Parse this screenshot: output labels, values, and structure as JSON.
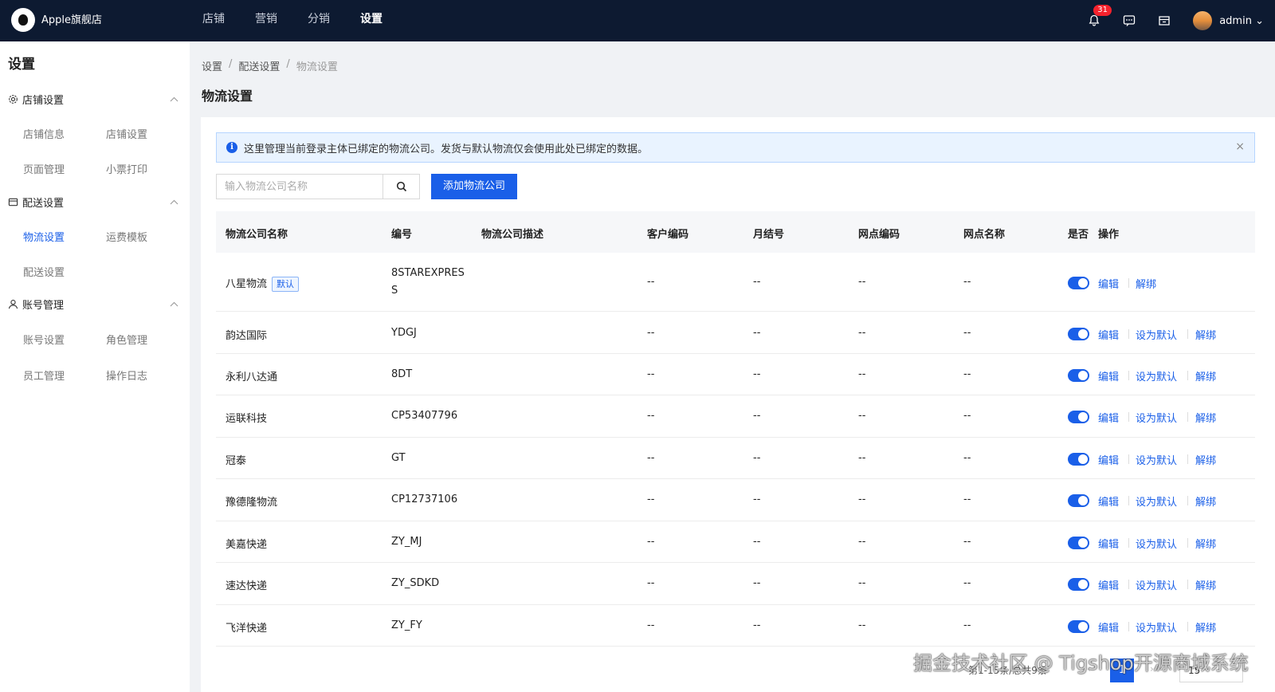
{
  "header": {
    "store_name": "Apple旗舰店",
    "nav": [
      "店铺",
      "营销",
      "分销",
      "设置"
    ],
    "notification_count": "31",
    "user": "admin"
  },
  "sidebar": {
    "title": "设置",
    "groups": [
      {
        "label": "店铺设置",
        "items": [
          "店铺信息",
          "店铺设置",
          "页面管理",
          "小票打印"
        ]
      },
      {
        "label": "配送设置",
        "items": [
          "物流设置",
          "运费模板",
          "配送设置"
        ]
      },
      {
        "label": "账号管理",
        "items": [
          "账号设置",
          "角色管理",
          "员工管理",
          "操作日志"
        ]
      }
    ]
  },
  "breadcrumb": [
    "设置",
    "配送设置",
    "物流设置"
  ],
  "page_title": "物流设置",
  "alert": {
    "message": "这里管理当前登录主体已绑定的物流公司。发货与默认物流仅会使用此处已绑定的数据。",
    "close": "×"
  },
  "search": {
    "placeholder": "输入物流公司名称"
  },
  "add_button": "添加物流公司",
  "table": {
    "headers": [
      "物流公司名称",
      "编号",
      "物流公司描述",
      "客户编码",
      "月结号",
      "网点编码",
      "网点名称",
      "是否",
      "操作"
    ],
    "default_tag": "默认",
    "actions": {
      "edit": "编辑",
      "set_default": "设为默认",
      "unbind": "解绑"
    },
    "rows": [
      {
        "name": "八星物流",
        "code_line1": "8STAREXPRES",
        "code_line2": "S",
        "customer": "--",
        "monthly": "--",
        "branch_code": "--",
        "branch_name": "--",
        "is_default": true
      },
      {
        "name": "韵达国际",
        "code": "YDGJ",
        "customer": "--",
        "monthly": "--",
        "branch_code": "--",
        "branch_name": "--"
      },
      {
        "name": "永利八达通",
        "code": "8DT",
        "customer": "--",
        "monthly": "--",
        "branch_code": "--",
        "branch_name": "--"
      },
      {
        "name": "运联科技",
        "code": "CP53407796",
        "customer": "--",
        "monthly": "--",
        "branch_code": "--",
        "branch_name": "--"
      },
      {
        "name": "冠泰",
        "code": "GT",
        "customer": "--",
        "monthly": "--",
        "branch_code": "--",
        "branch_name": "--"
      },
      {
        "name": "豫德隆物流",
        "code": "CP12737106",
        "customer": "--",
        "monthly": "--",
        "branch_code": "--",
        "branch_name": "--"
      },
      {
        "name": "美嘉快递",
        "code": "ZY_MJ",
        "customer": "--",
        "monthly": "--",
        "branch_code": "--",
        "branch_name": "--"
      },
      {
        "name": "速达快递",
        "code": "ZY_SDKD",
        "customer": "--",
        "monthly": "--",
        "branch_code": "--",
        "branch_name": "--"
      },
      {
        "name": "飞洋快递",
        "code": "ZY_FY",
        "customer": "--",
        "monthly": "--",
        "branch_code": "--",
        "branch_name": "--"
      }
    ]
  },
  "pagination": {
    "summary": "第1-15条/总共9条",
    "current_page": "1",
    "page_size": "15"
  },
  "watermark": "掘金技术社区 @ Tigshop开源商城系统",
  "colors": {
    "topbar": "#0d1a31",
    "accent": "#1a5fe8",
    "alert_bg": "#e9f3ff"
  }
}
